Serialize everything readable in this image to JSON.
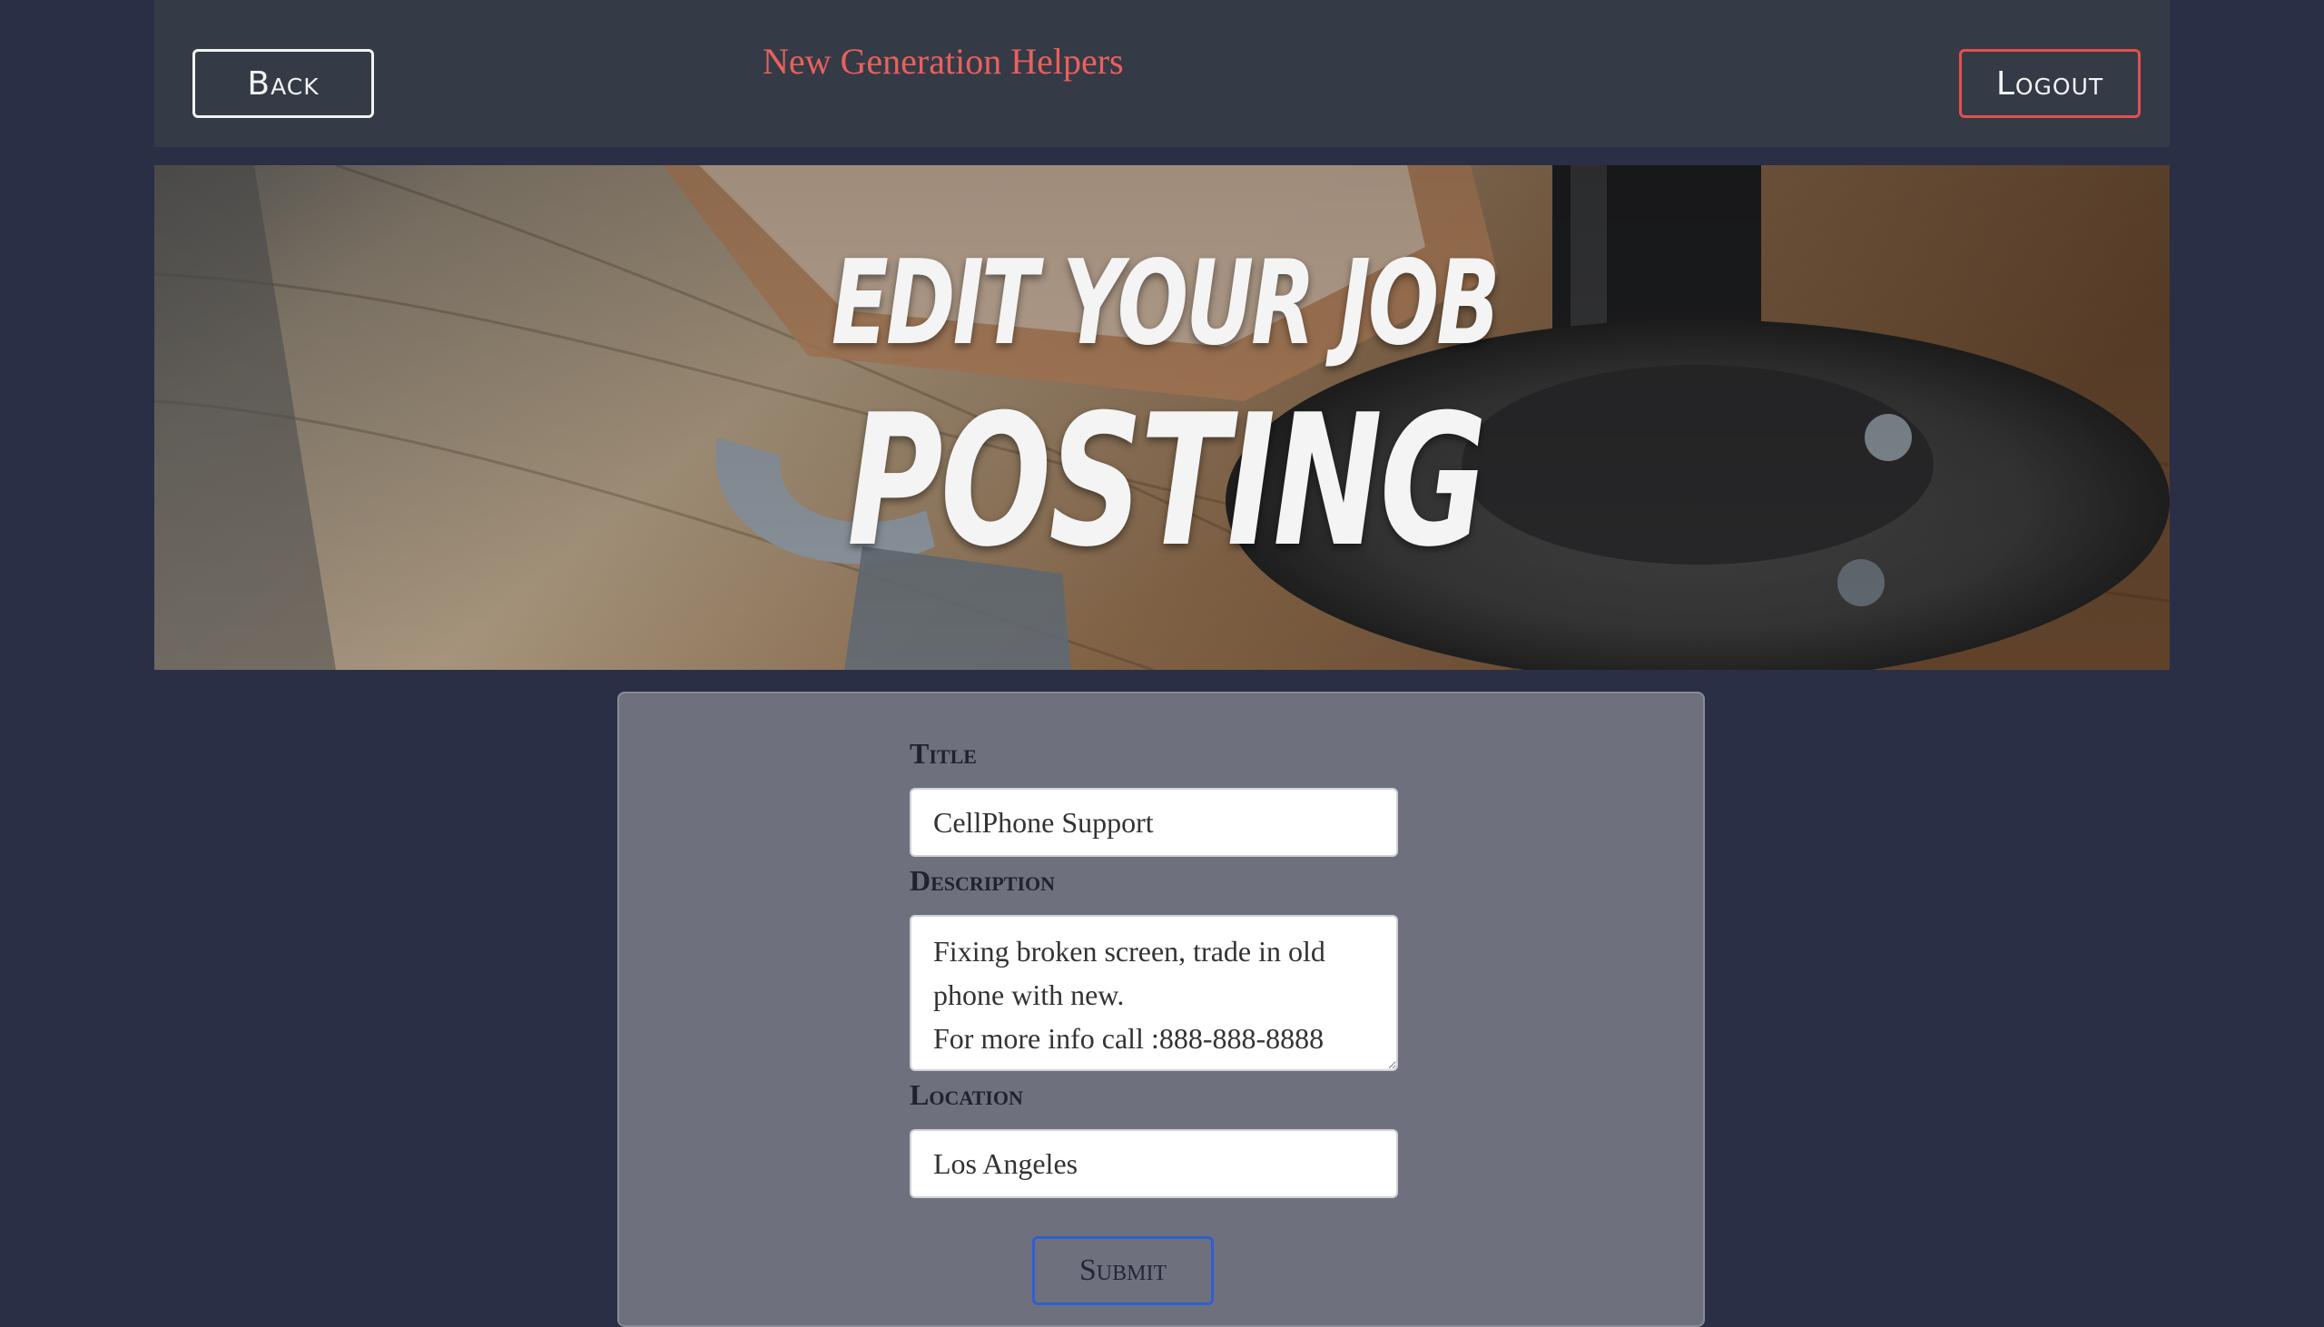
{
  "navbar": {
    "back_label": "Back",
    "brand": "New Generation Helpers",
    "logout_label": "Logout"
  },
  "hero": {
    "line1": "EDIT YOUR JOB",
    "line2": "POSTING",
    "background_image": "wooden-workbench-with-pipe-flange-and-tools"
  },
  "form": {
    "title_label": "Title",
    "title_value": "CellPhone Support",
    "description_label": "Description",
    "description_value": "Fixing broken screen, trade in old phone with new.\nFor more info call :888-888-8888",
    "location_label": "Location",
    "location_value": "Los Angeles",
    "submit_label": "Submit"
  },
  "colors": {
    "page_bg": "#2a2f45",
    "navbar_bg": "#353a47",
    "brand": "#e8615c",
    "logout_border": "#e2504f",
    "card_bg": "#6f707e",
    "submit_border": "#2f5fd0"
  }
}
